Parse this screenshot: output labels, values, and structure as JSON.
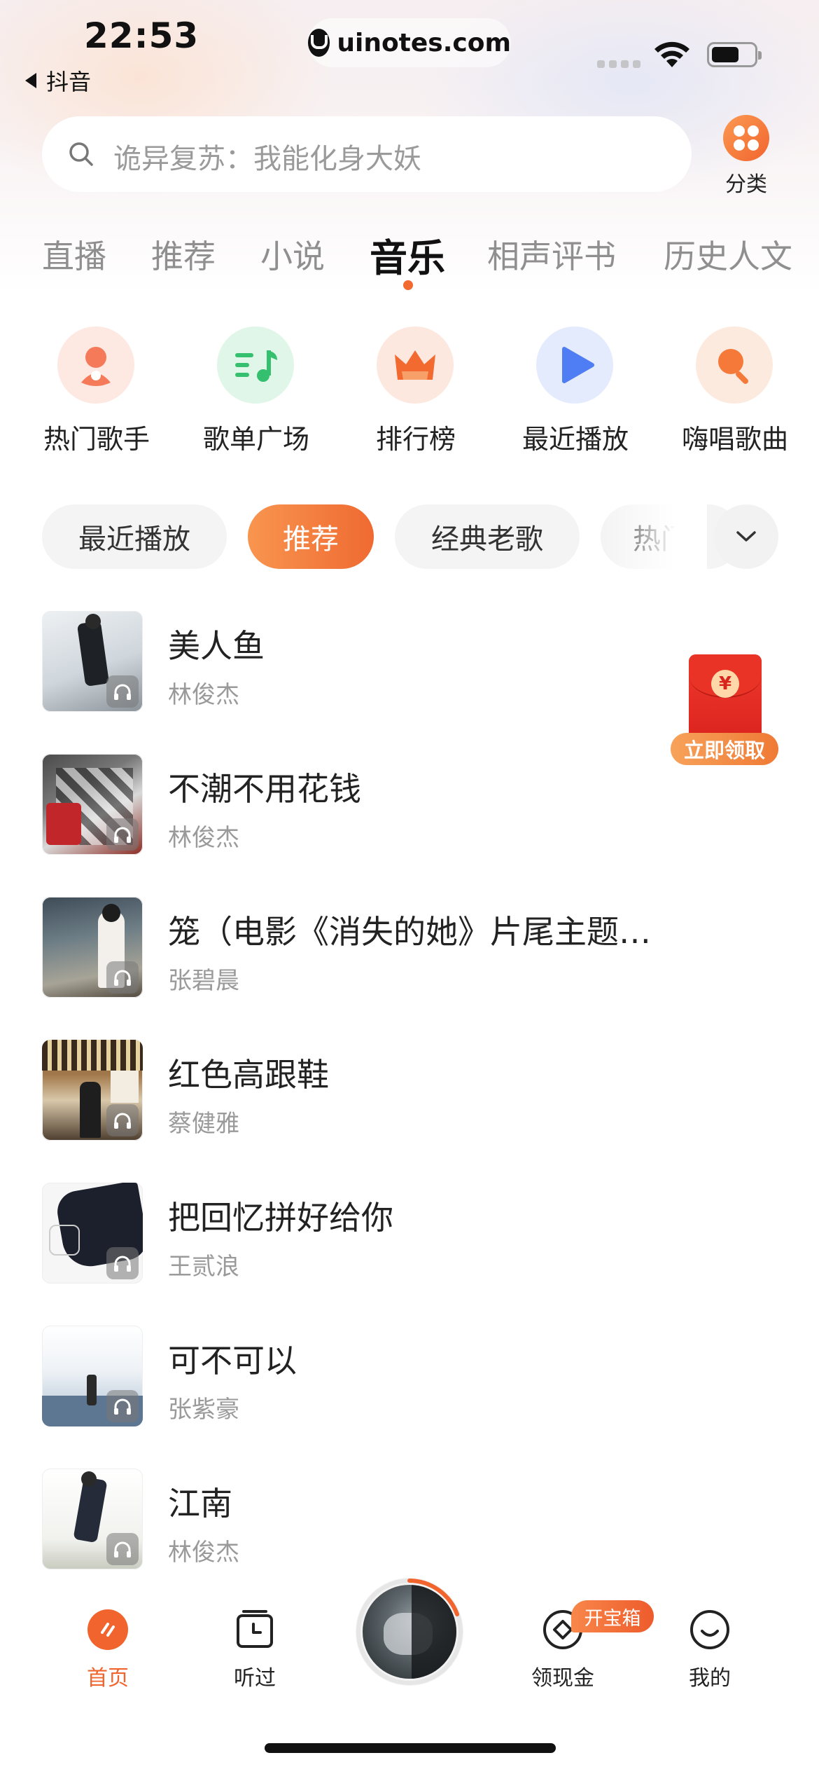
{
  "status": {
    "time": "22:53",
    "back_app": "抖音",
    "url": "uinotes.com"
  },
  "search": {
    "placeholder": "诡异复苏：我能化身大妖",
    "category_label": "分类"
  },
  "tabs": [
    {
      "label": "直播",
      "active": false
    },
    {
      "label": "推荐",
      "active": false
    },
    {
      "label": "小说",
      "active": false
    },
    {
      "label": "音乐",
      "active": true
    },
    {
      "label": "相声评书",
      "active": false
    },
    {
      "label": "历史人文",
      "active": false
    }
  ],
  "quick_entries": [
    {
      "label": "热门歌手",
      "icon": "singer-icon",
      "color": "#f47a5a"
    },
    {
      "label": "歌单广场",
      "icon": "playlist-icon",
      "color": "#34c06e"
    },
    {
      "label": "排行榜",
      "icon": "crown-icon",
      "color": "#f26a30"
    },
    {
      "label": "最近播放",
      "icon": "play-icon",
      "color": "#4f7df3"
    },
    {
      "label": "嗨唱歌曲",
      "icon": "microphone-icon",
      "color": "#f57a3a"
    }
  ],
  "filters": [
    {
      "label": "最近播放",
      "active": false
    },
    {
      "label": "推荐",
      "active": true
    },
    {
      "label": "经典老歌",
      "active": false
    },
    {
      "label": "热门",
      "active": false
    }
  ],
  "songs": [
    {
      "title": "美人鱼",
      "artist": "林俊杰"
    },
    {
      "title": "不潮不用花钱",
      "artist": "林俊杰"
    },
    {
      "title": "笼（电影《消失的她》片尾主题…",
      "artist": "张碧晨"
    },
    {
      "title": "红色高跟鞋",
      "artist": "蔡健雅"
    },
    {
      "title": "把回忆拼好给你",
      "artist": "王贰浪"
    },
    {
      "title": "可不可以",
      "artist": "张紫豪"
    },
    {
      "title": "江南",
      "artist": "林俊杰"
    }
  ],
  "redpack": {
    "label": "立即领取"
  },
  "nav": {
    "home": "首页",
    "history": "听过",
    "cash": "领现金",
    "cash_badge": "开宝箱",
    "me": "我的"
  },
  "colors": {
    "accent": "#f26a30",
    "text_primary": "#222222",
    "text_secondary": "#9a9a9a"
  }
}
